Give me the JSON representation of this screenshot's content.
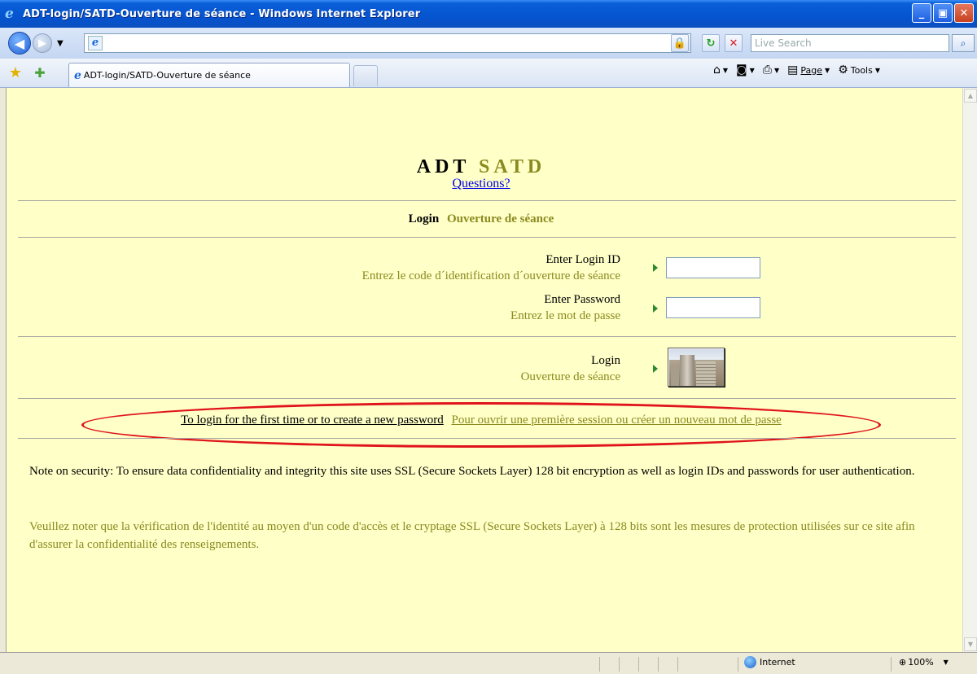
{
  "window": {
    "title": "ADT-login/SATD-Ouverture de séance - Windows Internet Explorer",
    "minimize": "_",
    "maximize": "▣",
    "close": "✕"
  },
  "addressbar": {
    "url": "",
    "search_placeholder": "Live Search"
  },
  "tabs": [
    {
      "label": "ADT-login/SATD-Ouverture de séance",
      "active": true
    }
  ],
  "commandbar": {
    "page_label": "Page",
    "tools_label": "Tools"
  },
  "page": {
    "title_en": "ADT",
    "title_fr": "SATD",
    "questions_link": "Questions?",
    "heading_en": "Login",
    "heading_fr": "Ouverture de séance",
    "login_id_label_en": "Enter Login ID",
    "login_id_label_fr": "Entrez le code d´identification d´ouverture de séance",
    "password_label_en": "Enter Password",
    "password_label_fr": "Entrez le mot de passe",
    "login_button_label_en": "Login",
    "login_button_label_fr": "Ouverture de séance",
    "first_time_link_en": "To login for the first time or to create a new password",
    "first_time_link_fr": "Pour ouvrir une première session ou créer un nouveau mot de passe",
    "security_note_en": "Note on security: To ensure data confidentiality and integrity this site uses SSL (Secure Sockets Layer) 128 bit encryption as well as login IDs and passwords for user authentication.",
    "security_note_fr": "Veuillez noter que la vérification de l'identité au moyen d'un code d'accès et le cryptage SSL (Secure Sockets Layer) à 128 bits sont les mesures de protection utilisées sur ce site afin d'assurer la confidentialité des renseignements."
  },
  "statusbar": {
    "zone": "Internet",
    "zoom": "100%"
  },
  "colors": {
    "page_background": "#ffffc8",
    "french_text": "#8a8a20",
    "highlight_ellipse": "#e0141b",
    "link": "#0000ee"
  }
}
